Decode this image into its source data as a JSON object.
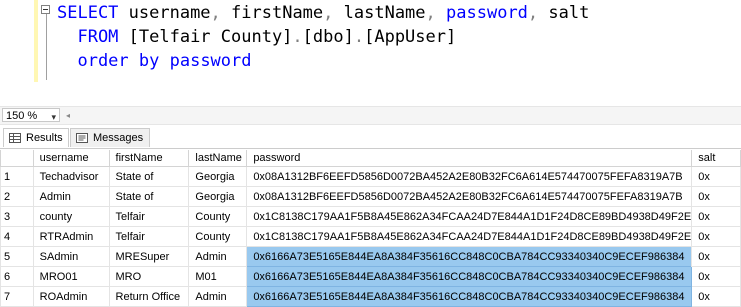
{
  "editor": {
    "lines": [
      {
        "tokens": [
          {
            "t": "SELECT",
            "c": "kw"
          },
          {
            "t": " username",
            "c": "txt"
          },
          {
            "t": ",",
            "c": "gray"
          },
          {
            "t": " firstName",
            "c": "txt"
          },
          {
            "t": ",",
            "c": "gray"
          },
          {
            "t": " lastName",
            "c": "txt"
          },
          {
            "t": ",",
            "c": "gray"
          },
          {
            "t": " ",
            "c": "txt"
          },
          {
            "t": "password",
            "c": "kw"
          },
          {
            "t": ",",
            "c": "gray"
          },
          {
            "t": " salt",
            "c": "txt"
          }
        ]
      },
      {
        "tokens": [
          {
            "t": "  FROM",
            "c": "kw"
          },
          {
            "t": " [Telfair County]",
            "c": "txt"
          },
          {
            "t": ".",
            "c": "gray"
          },
          {
            "t": "[dbo]",
            "c": "txt"
          },
          {
            "t": ".",
            "c": "gray"
          },
          {
            "t": "[AppUser]",
            "c": "txt"
          }
        ]
      },
      {
        "tokens": [
          {
            "t": "  order by",
            "c": "kw"
          },
          {
            "t": " ",
            "c": "txt"
          },
          {
            "t": "password",
            "c": "kw"
          }
        ]
      }
    ]
  },
  "zoom": {
    "value": "150 %"
  },
  "tabs": {
    "results": "Results",
    "messages": "Messages"
  },
  "grid": {
    "columns": [
      "username",
      "firstName",
      "lastName",
      "password",
      "salt"
    ],
    "rows": [
      {
        "n": "1",
        "username": "Techadvisor",
        "firstName": "State of",
        "lastName": "Georgia",
        "password": "0x08A1312BF6EEFD5856D0072BA452A2E80B32FC6A614E574470075FEFA8319A7B",
        "salt": "0x",
        "selected": false
      },
      {
        "n": "2",
        "username": "Admin",
        "firstName": "State of",
        "lastName": "Georgia",
        "password": "0x08A1312BF6EEFD5856D0072BA452A2E80B32FC6A614E574470075FEFA8319A7B",
        "salt": "0x",
        "selected": false
      },
      {
        "n": "3",
        "username": "county",
        "firstName": "Telfair",
        "lastName": "County",
        "password": "0x1C8138C179AA1F5B8A45E862A34FCAA24D7E844A1D1F24D8CE89BD4938D49F2E",
        "salt": "0x",
        "selected": false
      },
      {
        "n": "4",
        "username": "RTRAdmin",
        "firstName": "Telfair",
        "lastName": "County",
        "password": "0x1C8138C179AA1F5B8A45E862A34FCAA24D7E844A1D1F24D8CE89BD4938D49F2E",
        "salt": "0x",
        "selected": false
      },
      {
        "n": "5",
        "username": "SAdmin",
        "firstName": "MRESuper",
        "lastName": "Admin",
        "password": "0x6166A73E5165E844EA8A384F35616CC848C0CBA784CC93340340C9ECEF986384",
        "salt": "0x",
        "selected": true
      },
      {
        "n": "6",
        "username": "MRO01",
        "firstName": "MRO",
        "lastName": "M01",
        "password": "0x6166A73E5165E844EA8A384F35616CC848C0CBA784CC93340340C9ECEF986384",
        "salt": "0x",
        "selected": true
      },
      {
        "n": "7",
        "username": "ROAdmin",
        "firstName": "Return Office",
        "lastName": "Admin",
        "password": "0x6166A73E5165E844EA8A384F35616CC848C0CBA784CC93340340C9ECEF986384",
        "salt": "0x",
        "selected": true
      }
    ]
  }
}
